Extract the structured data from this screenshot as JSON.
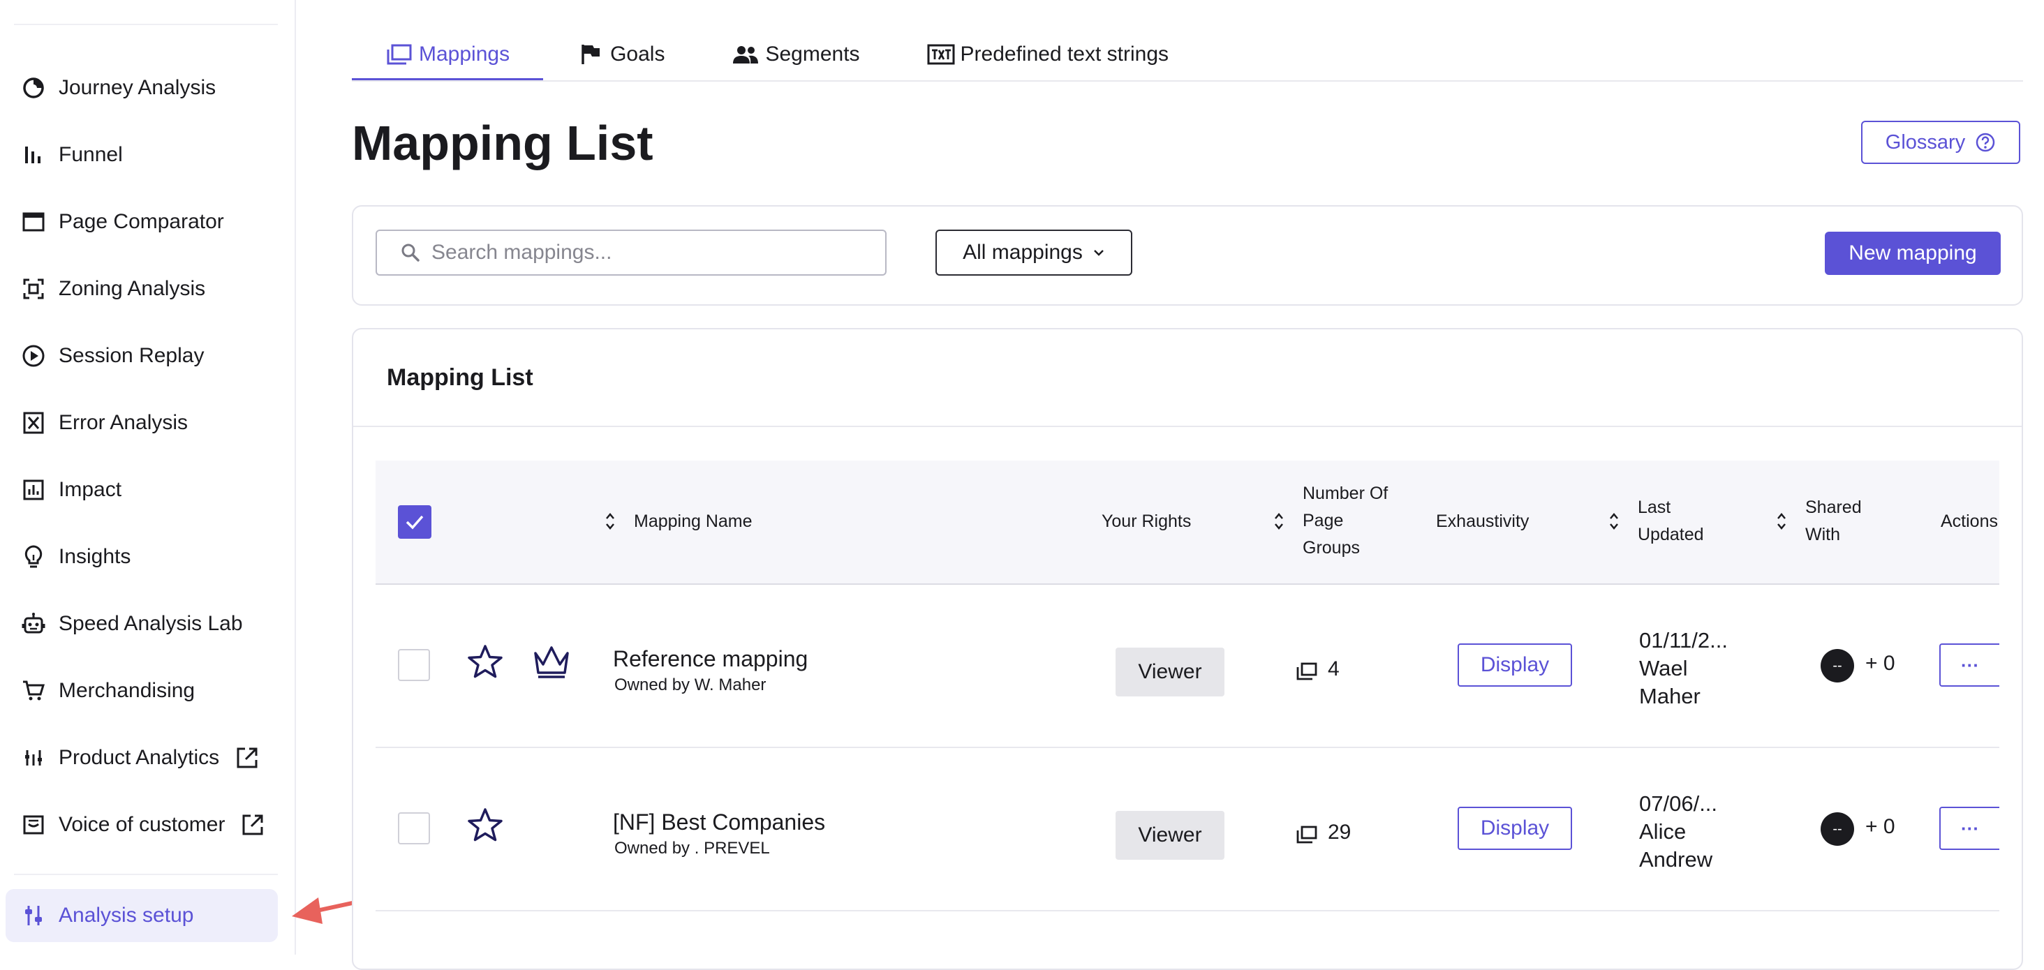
{
  "sidebar": {
    "items": [
      {
        "label": "Journey Analysis",
        "icon": "journey-icon"
      },
      {
        "label": "Funnel",
        "icon": "funnel-icon"
      },
      {
        "label": "Page Comparator",
        "icon": "page-comparator-icon"
      },
      {
        "label": "Zoning Analysis",
        "icon": "zoning-icon"
      },
      {
        "label": "Session Replay",
        "icon": "play-circle-icon"
      },
      {
        "label": "Error Analysis",
        "icon": "error-icon"
      },
      {
        "label": "Impact",
        "icon": "impact-chart-icon"
      },
      {
        "label": "Insights",
        "icon": "lightbulb-icon"
      },
      {
        "label": "Speed Analysis Lab",
        "icon": "robot-icon"
      },
      {
        "label": "Merchandising",
        "icon": "cart-icon"
      },
      {
        "label": "Product Analytics",
        "icon": "product-analytics-icon",
        "external": true
      },
      {
        "label": "Voice of customer",
        "icon": "voice-icon",
        "external": true
      }
    ],
    "active_item": {
      "label": "Analysis setup",
      "icon": "sliders-icon"
    }
  },
  "tabs": [
    {
      "label": "Mappings",
      "icon": "mappings-icon",
      "active": true
    },
    {
      "label": "Goals",
      "icon": "flag-icon"
    },
    {
      "label": "Segments",
      "icon": "people-icon"
    },
    {
      "label": "Predefined text strings",
      "icon": "txt-icon"
    }
  ],
  "header": {
    "title": "Mapping List",
    "glossary_label": "Glossary"
  },
  "toolbar": {
    "search_placeholder": "Search mappings...",
    "filter_value": "All mappings",
    "new_button_label": "New mapping"
  },
  "list": {
    "title": "Mapping List",
    "columns": {
      "name": "Mapping Name",
      "rights": "Your Rights",
      "groups": [
        "Number Of",
        "Page",
        "Groups"
      ],
      "exhaustivity": "Exhaustivity",
      "updated": [
        "Last",
        "Updated"
      ],
      "shared": [
        "Shared",
        "With"
      ],
      "actions": "Actions"
    },
    "rows": [
      {
        "name": "Reference mapping",
        "owner": "Owned by W. Maher",
        "rights": "Viewer",
        "page_groups": "4",
        "exhaustivity_label": "Display",
        "updated_lines": [
          "01/11/2...",
          "Wael",
          "Maher"
        ],
        "avatar": "--",
        "shared_extra": "+ 0",
        "actions_label": "···",
        "reference": true
      },
      {
        "name": "[NF] Best Companies",
        "owner": "Owned by . PREVEL",
        "rights": "Viewer",
        "page_groups": "29",
        "exhaustivity_label": "Display",
        "updated_lines": [
          "07/06/...",
          "Alice",
          "Andrew"
        ],
        "avatar": "--",
        "shared_extra": "+ 0",
        "actions_label": "···",
        "reference": false
      }
    ]
  },
  "colors": {
    "accent": "#5b52d6",
    "annotation_arrow": "#e8625c"
  }
}
